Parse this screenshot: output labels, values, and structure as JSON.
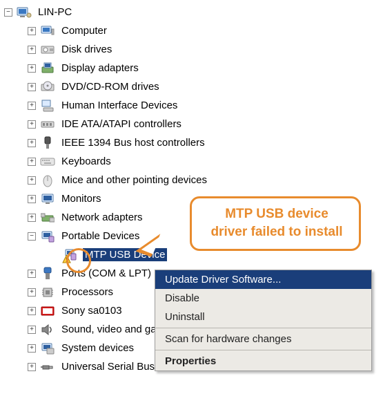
{
  "root": {
    "label": "LIN-PC",
    "expander": "−"
  },
  "categories": [
    {
      "label": "Computer",
      "expander": "+",
      "icon": "computer-icon"
    },
    {
      "label": "Disk drives",
      "expander": "+",
      "icon": "disk-icon"
    },
    {
      "label": "Display adapters",
      "expander": "+",
      "icon": "display-icon"
    },
    {
      "label": "DVD/CD-ROM drives",
      "expander": "+",
      "icon": "dvd-icon"
    },
    {
      "label": "Human Interface Devices",
      "expander": "+",
      "icon": "hid-icon"
    },
    {
      "label": "IDE ATA/ATAPI controllers",
      "expander": "+",
      "icon": "ide-icon"
    },
    {
      "label": "IEEE 1394 Bus host controllers",
      "expander": "+",
      "icon": "ieee-icon"
    },
    {
      "label": "Keyboards",
      "expander": "+",
      "icon": "keyboard-icon"
    },
    {
      "label": "Mice and other pointing devices",
      "expander": "+",
      "icon": "mouse-icon"
    },
    {
      "label": "Monitors",
      "expander": "+",
      "icon": "monitor-icon"
    },
    {
      "label": "Network adapters",
      "expander": "+",
      "icon": "network-icon"
    },
    {
      "label": "Portable Devices",
      "expander": "−",
      "icon": "portable-icon"
    },
    {
      "label": "Ports (COM & LPT)",
      "expander": "+",
      "icon": "ports-icon"
    },
    {
      "label": "Processors",
      "expander": "+",
      "icon": "cpu-icon"
    },
    {
      "label": "Sony sa0103",
      "expander": "+",
      "icon": "sony-icon"
    },
    {
      "label": "Sound, video and game controllers",
      "expander": "+",
      "icon": "sound-icon"
    },
    {
      "label": "System devices",
      "expander": "+",
      "icon": "system-icon"
    },
    {
      "label": "Universal Serial Bus controllers",
      "expander": "+",
      "icon": "usb-icon"
    }
  ],
  "child": {
    "label": "MTP USB Device"
  },
  "contextMenu": {
    "items": [
      {
        "label": "Update Driver Software...",
        "highlight": true
      },
      {
        "label": "Disable"
      },
      {
        "label": "Uninstall"
      }
    ],
    "scan": "Scan for hardware changes",
    "properties": "Properties"
  },
  "callout": {
    "line1": "MTP USB device",
    "line2": "driver failed to install"
  }
}
